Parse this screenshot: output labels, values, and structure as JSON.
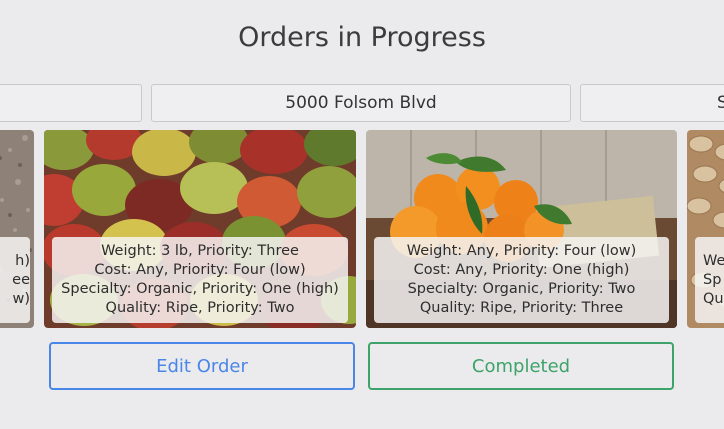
{
  "page": {
    "title": "Orders in Progress"
  },
  "addresses": [
    "",
    "5000 Folsom Blvd",
    "S"
  ],
  "cards": [
    {
      "image": "gravel-photo",
      "lines": [
        "h)",
        "ee",
        "w)"
      ]
    },
    {
      "image": "mangoes-photo",
      "lines": [
        "Weight: 3 lb, Priority: Three",
        "Cost: Any, Priority: Four (low)",
        "Specialty: Organic, Priority: One (high)",
        "Quality: Ripe, Priority: Two"
      ],
      "button": {
        "label": "Edit Order",
        "color": "#4a86e8"
      }
    },
    {
      "image": "oranges-photo",
      "lines": [
        "Weight: Any, Priority: Four (low)",
        "Cost: Any, Priority: One (high)",
        "Specialty: Organic, Priority: Two",
        "Quality: Ripe, Priority: Three"
      ],
      "button": {
        "label": "Completed",
        "color": "#3ea36a"
      }
    },
    {
      "image": "pistachios-photo",
      "lines": [
        "We",
        "",
        "Sp",
        "Qu"
      ]
    }
  ]
}
